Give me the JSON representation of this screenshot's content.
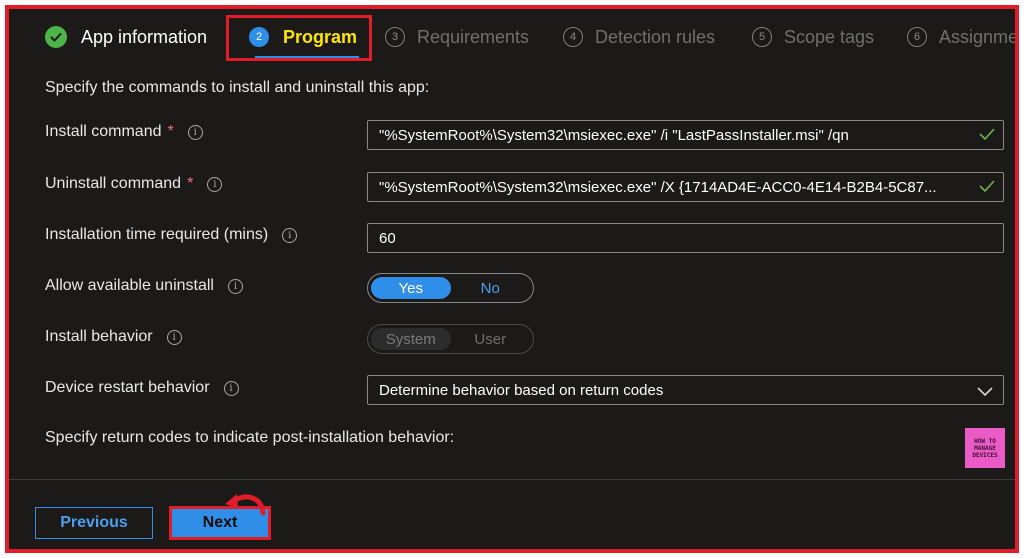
{
  "tabs": [
    {
      "number": "",
      "label": "App information",
      "state": "completed"
    },
    {
      "number": "2",
      "label": "Program",
      "state": "active"
    },
    {
      "number": "3",
      "label": "Requirements",
      "state": "pending"
    },
    {
      "number": "4",
      "label": "Detection rules",
      "state": "pending"
    },
    {
      "number": "5",
      "label": "Scope tags",
      "state": "pending"
    },
    {
      "number": "6",
      "label": "Assignme",
      "state": "pending"
    }
  ],
  "intro": "Specify the commands to install and uninstall this app:",
  "install_command": {
    "label": "Install command",
    "required_mark": "*",
    "value": "\"%SystemRoot%\\System32\\msiexec.exe\" /i \"LastPassInstaller.msi\" /qn"
  },
  "uninstall_command": {
    "label": "Uninstall command",
    "required_mark": "*",
    "value": "\"%SystemRoot%\\System32\\msiexec.exe\" /X {1714AD4E-ACC0-4E14-B2B4-5C87..."
  },
  "installation_time": {
    "label": "Installation time required (mins)",
    "value": "60"
  },
  "allow_uninstall": {
    "label": "Allow available uninstall",
    "options": [
      "Yes",
      "No"
    ],
    "selected": "Yes"
  },
  "install_behavior": {
    "label": "Install behavior",
    "options": [
      "System",
      "User"
    ],
    "selected": "System",
    "disabled": true
  },
  "restart_behavior": {
    "label": "Device restart behavior",
    "value": "Determine behavior based on return codes"
  },
  "return_codes_text": "Specify return codes to indicate post-installation behavior:",
  "logo": {
    "line1": "HOW TO",
    "line2": "MANAGE",
    "line3": "DEVICES"
  },
  "buttons": {
    "previous": "Previous",
    "next": "Next"
  },
  "colors": {
    "background": "#1b1a19",
    "accent": "#2f8fe8",
    "highlight_border": "#e11d2a",
    "active_tab_text": "#ffe600",
    "success": "#4fb448",
    "required": "#f1707b"
  },
  "icons": {
    "completed_step": "check-circle-icon",
    "info": "info-icon",
    "valid": "checkmark-icon",
    "dropdown": "chevron-down-icon",
    "annotation": "curved-arrow-icon"
  }
}
